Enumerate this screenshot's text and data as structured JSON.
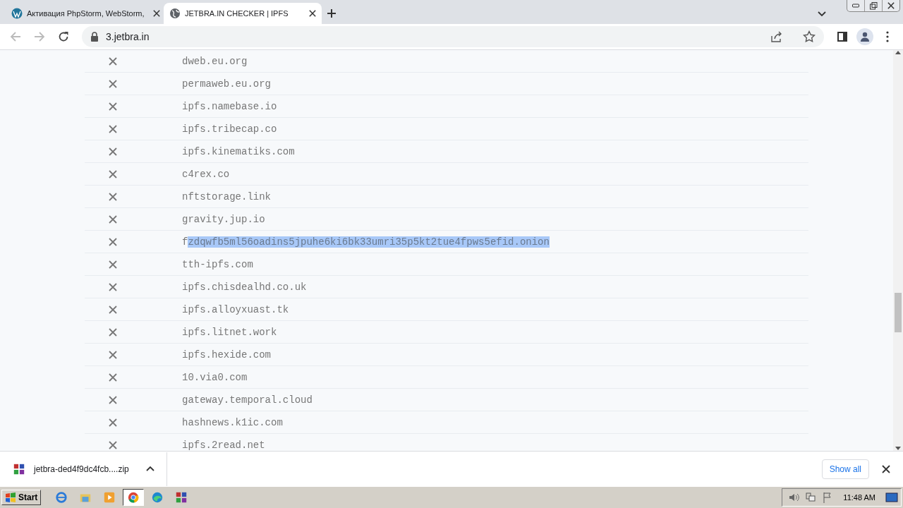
{
  "tabs": [
    {
      "title": "Активация PhpStorm, WebStorm,",
      "selected": false
    },
    {
      "title": "JETBRA.IN CHECKER | IPFS",
      "selected": true
    }
  ],
  "address": "3.jetbra.in",
  "rows": [
    {
      "text": "dweb.eu.org"
    },
    {
      "text": "permaweb.eu.org"
    },
    {
      "text": "ipfs.namebase.io"
    },
    {
      "text": "ipfs.tribecap.co"
    },
    {
      "text": "ipfs.kinematiks.com"
    },
    {
      "text": "c4rex.co"
    },
    {
      "text": "nftstorage.link"
    },
    {
      "text": "gravity.jup.io"
    },
    {
      "text": "f",
      "highlight": "zdqwfb5ml56oadins5jpuhe6ki6bk33umri35p5kt2tue4fpws5efid.onion"
    },
    {
      "text": "tth-ipfs.com"
    },
    {
      "text": "ipfs.chisdealhd.co.uk"
    },
    {
      "text": "ipfs.alloyxuast.tk"
    },
    {
      "text": "ipfs.litnet.work"
    },
    {
      "text": "ipfs.hexide.com"
    },
    {
      "text": "10.via0.com"
    },
    {
      "text": "gateway.temporal.cloud"
    },
    {
      "text": "hashnews.k1ic.com"
    },
    {
      "text": "ipfs.2read.net"
    }
  ],
  "download": {
    "file": "jetbra-ded4f9dc4fcb....zip",
    "show_all": "Show all"
  },
  "taskbar": {
    "start": "Start",
    "apps": [
      {
        "selected": false
      },
      {
        "selected": false
      },
      {
        "selected": false
      },
      {
        "selected": true
      },
      {
        "selected": false
      },
      {
        "selected": false
      }
    ],
    "clock": "11:48 AM"
  }
}
